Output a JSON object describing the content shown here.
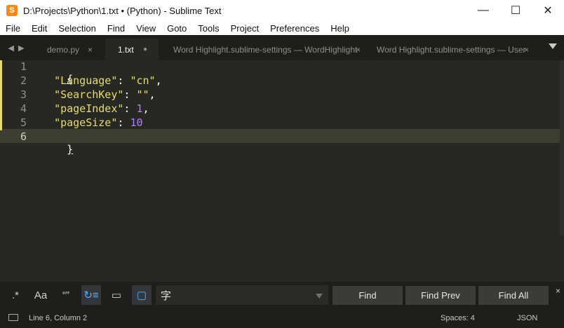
{
  "window": {
    "icon_letter": "S",
    "title": "D:\\Projects\\Python\\1.txt • (Python) - Sublime Text",
    "controls": [
      "minimize-icon",
      "maximize-icon",
      "close-icon"
    ],
    "control_glyphs": [
      "—",
      "☐",
      "✕"
    ]
  },
  "menu": [
    "File",
    "Edit",
    "Selection",
    "Find",
    "View",
    "Goto",
    "Tools",
    "Project",
    "Preferences",
    "Help"
  ],
  "tabs": [
    {
      "label": "demo.py",
      "marker": "×",
      "active": false
    },
    {
      "label": "1.txt",
      "marker": "●",
      "active": true
    },
    {
      "label": "Word Highlight.sublime-settings — WordHighlight",
      "marker": "×",
      "active": false
    },
    {
      "label": "Word Highlight.sublime-settings — User",
      "marker": "×",
      "active": false
    }
  ],
  "tab_nav": {
    "left": "◀",
    "right": "▶"
  },
  "editor": {
    "line_numbers": [
      "1",
      "2",
      "3",
      "4",
      "5",
      "6"
    ],
    "current_line": 6,
    "lines": [
      {
        "text": "{"
      },
      {
        "key": "\"Language\"",
        "sep": ": ",
        "value": "\"cn\"",
        "tail": ","
      },
      {
        "key": "\"SearchKey\"",
        "sep": ": ",
        "value": "\"\"",
        "tail": ","
      },
      {
        "key": "\"pageIndex\"",
        "sep": ": ",
        "value": "1",
        "tail": ","
      },
      {
        "key": "\"pageSize\"",
        "sep": ": ",
        "value": "10",
        "tail": ""
      },
      {
        "text": "}"
      }
    ],
    "colors": {
      "background": "#272822",
      "string": "#e6db74",
      "number": "#ae81ff",
      "text": "#f8f8f2",
      "gutter": "#90908a"
    }
  },
  "findbar": {
    "options": [
      ".*",
      "Aa",
      "“”",
      "↻≡",
      "▭",
      "▢"
    ],
    "input_value": "字",
    "find_label": "Find",
    "find_prev_label": "Find Prev",
    "find_all_label": "Find All",
    "close_glyph": "×",
    "accent": "#4fb0ff"
  },
  "status": {
    "position": "Line 6, Column 2",
    "indent": "Spaces: 4",
    "syntax": "JSON"
  }
}
